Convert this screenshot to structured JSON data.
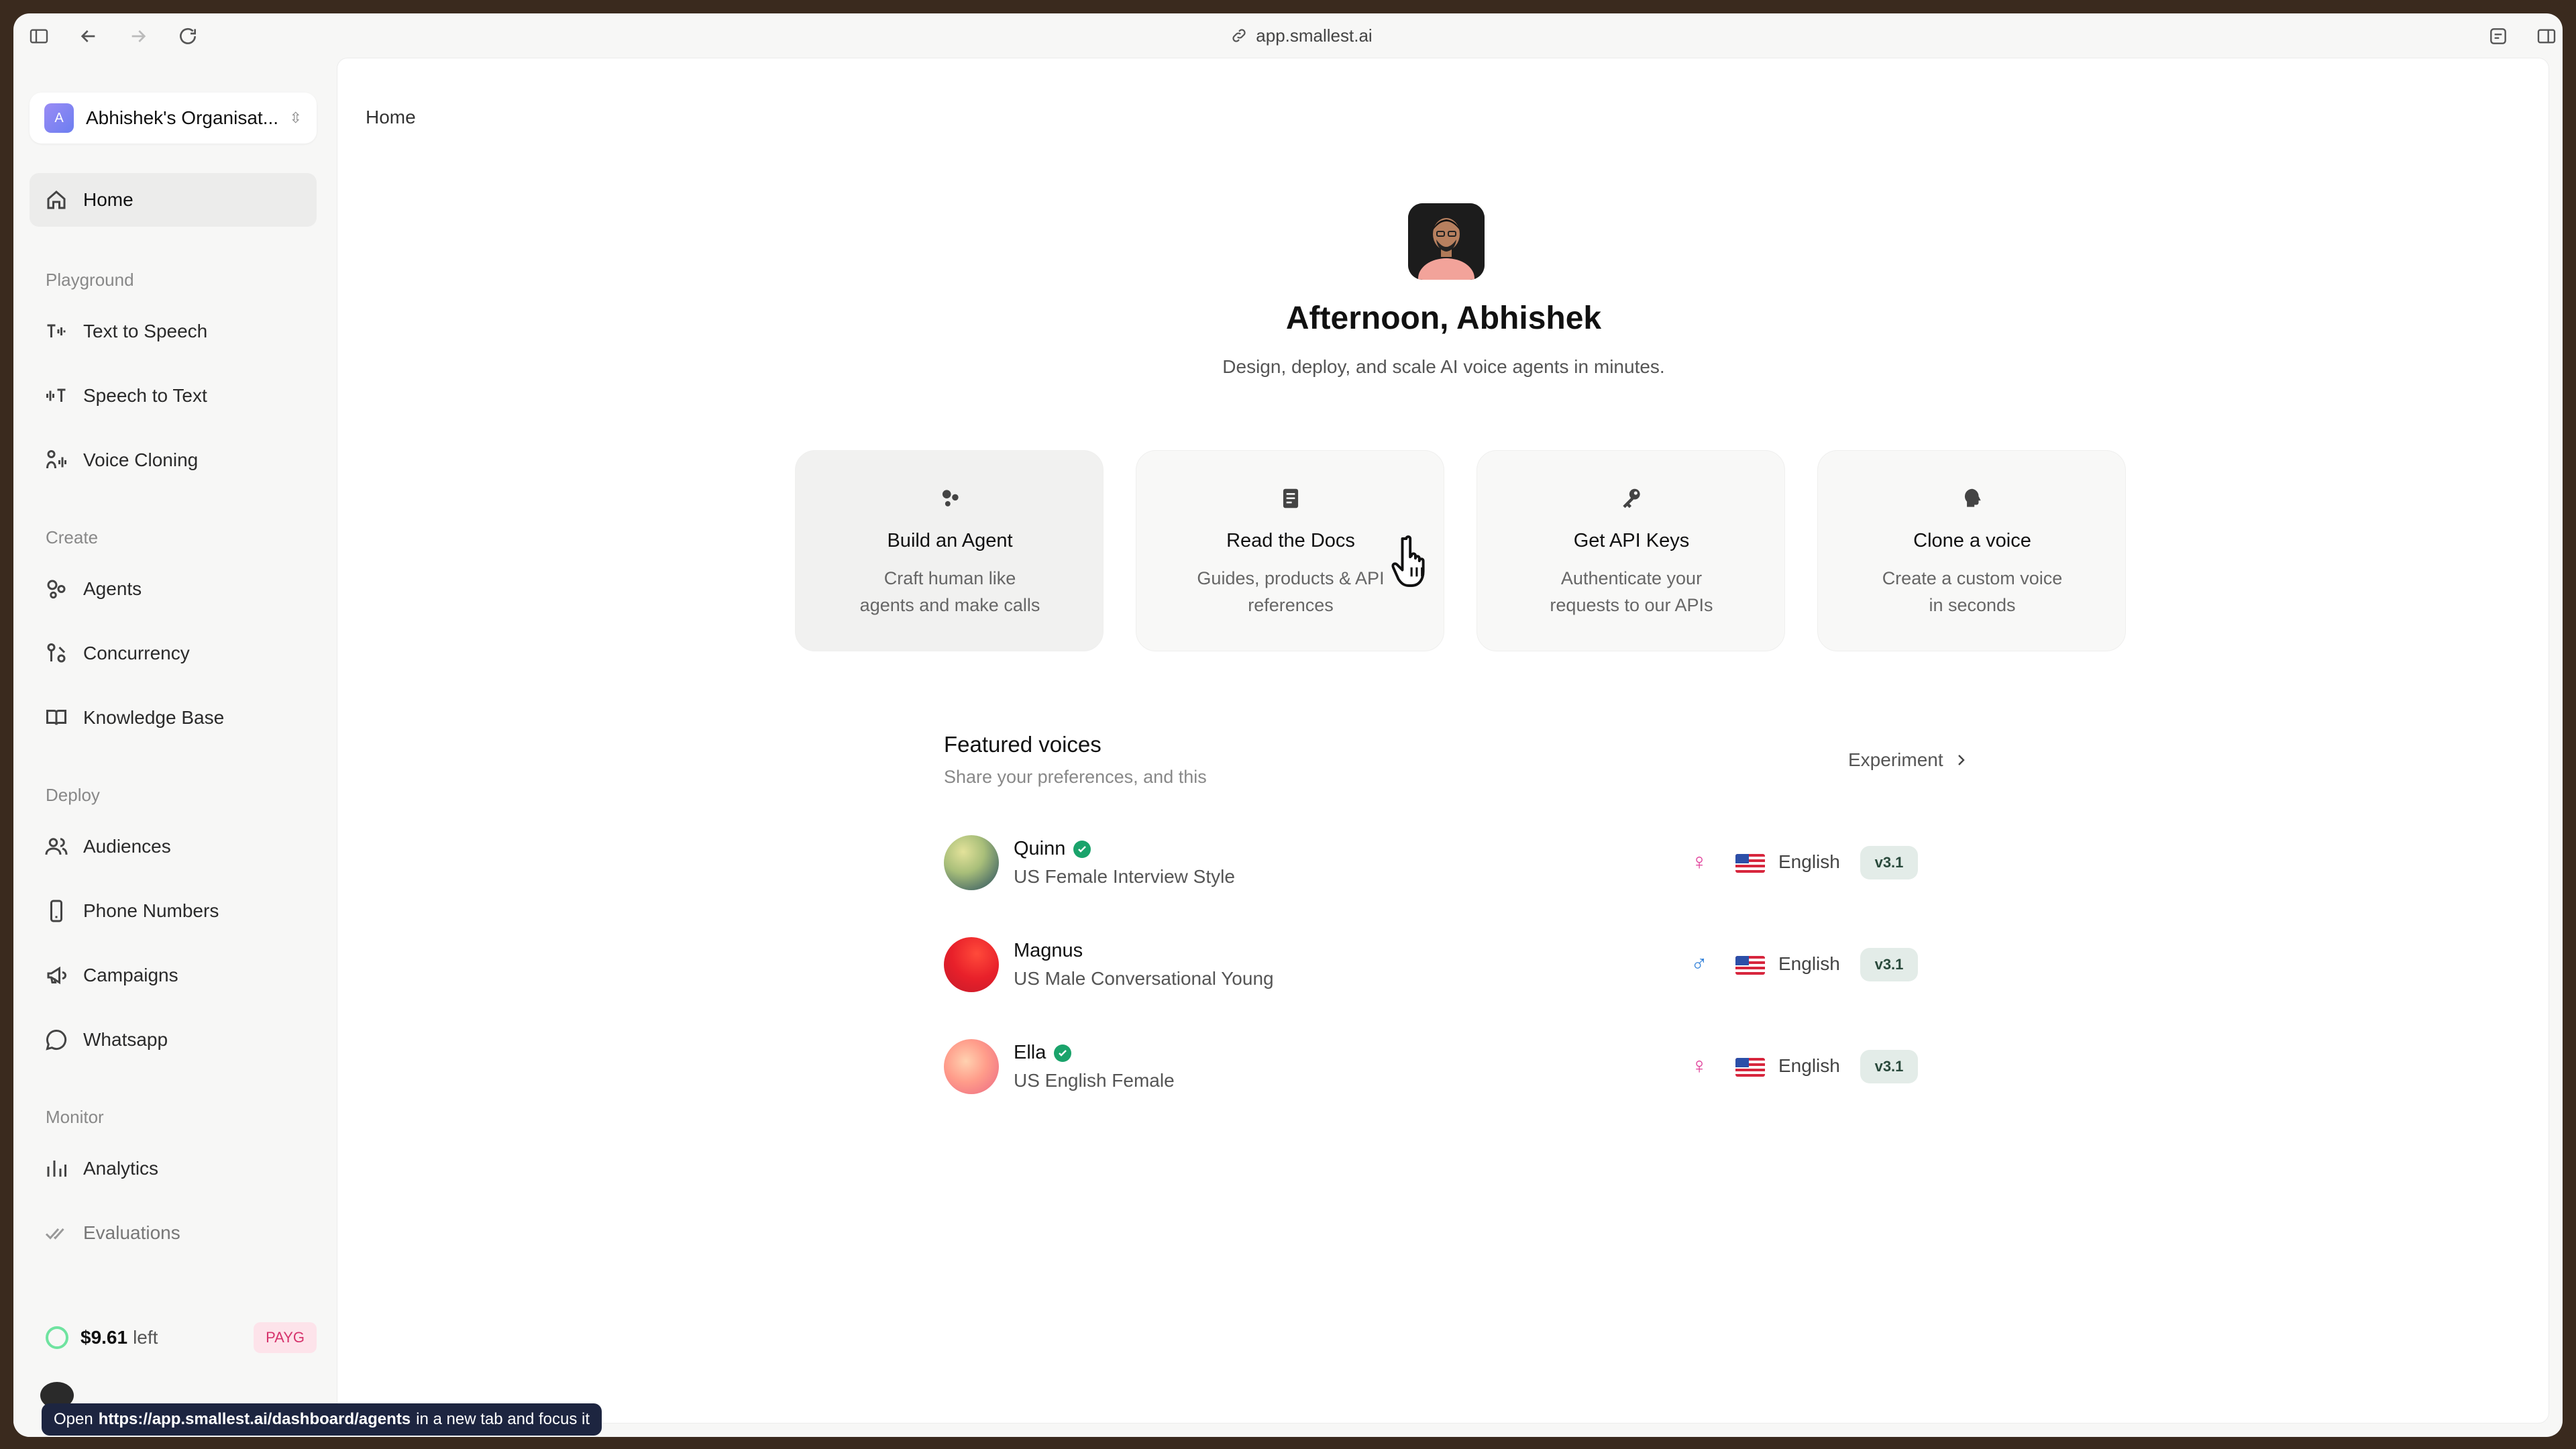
{
  "browser": {
    "url": "app.smallest.ai"
  },
  "sidebar": {
    "org_initial": "A",
    "org_name": "Abhishek's Organisat...",
    "home": "Home",
    "sections": {
      "playground": "Playground",
      "create": "Create",
      "deploy": "Deploy",
      "monitor": "Monitor"
    },
    "items": {
      "tts": "Text to Speech",
      "stt": "Speech to Text",
      "voice_cloning": "Voice Cloning",
      "agents": "Agents",
      "concurrency": "Concurrency",
      "knowledge_base": "Knowledge Base",
      "audiences": "Audiences",
      "phone_numbers": "Phone Numbers",
      "campaigns": "Campaigns",
      "whatsapp": "Whatsapp",
      "analytics": "Analytics",
      "evaluations": "Evaluations"
    },
    "credit_amount": "$9.61",
    "credit_left": "left",
    "plan_badge": "PAYG"
  },
  "main": {
    "breadcrumb": "Home",
    "greeting": "Afternoon, Abhishek",
    "subtitle": "Design, deploy, and scale AI voice agents in minutes.",
    "cards": [
      {
        "title": "Build an Agent",
        "line1": "Craft human like",
        "line2": "agents and make calls"
      },
      {
        "title": "Read the Docs",
        "line1": "Guides, products & API",
        "line2": "references"
      },
      {
        "title": "Get API Keys",
        "line1": "Authenticate your",
        "line2": "requests to our APIs"
      },
      {
        "title": "Clone a voice",
        "line1": "Create a custom voice",
        "line2": "in seconds"
      }
    ],
    "featured_title": "Featured voices",
    "featured_sub": "Share your preferences, and this",
    "experiment": "Experiment",
    "voices": [
      {
        "name": "Quinn",
        "desc": "US Female Interview Style",
        "language": "English",
        "version": "v3.1",
        "gender_symbol": "♀",
        "gender_color": "#e0409a",
        "verified": true
      },
      {
        "name": "Magnus",
        "desc": "US Male Conversational Young",
        "language": "English",
        "version": "v3.1",
        "gender_symbol": "♂",
        "gender_color": "#2f7fd8",
        "verified": false
      },
      {
        "name": "Ella",
        "desc": "US English Female",
        "language": "English",
        "version": "v3.1",
        "gender_symbol": "♀",
        "gender_color": "#e0409a",
        "verified": true
      }
    ]
  },
  "statusbar": {
    "prefix": "Open",
    "url": "https://app.smallest.ai/dashboard/agents",
    "suffix": "in a new tab and focus it"
  }
}
